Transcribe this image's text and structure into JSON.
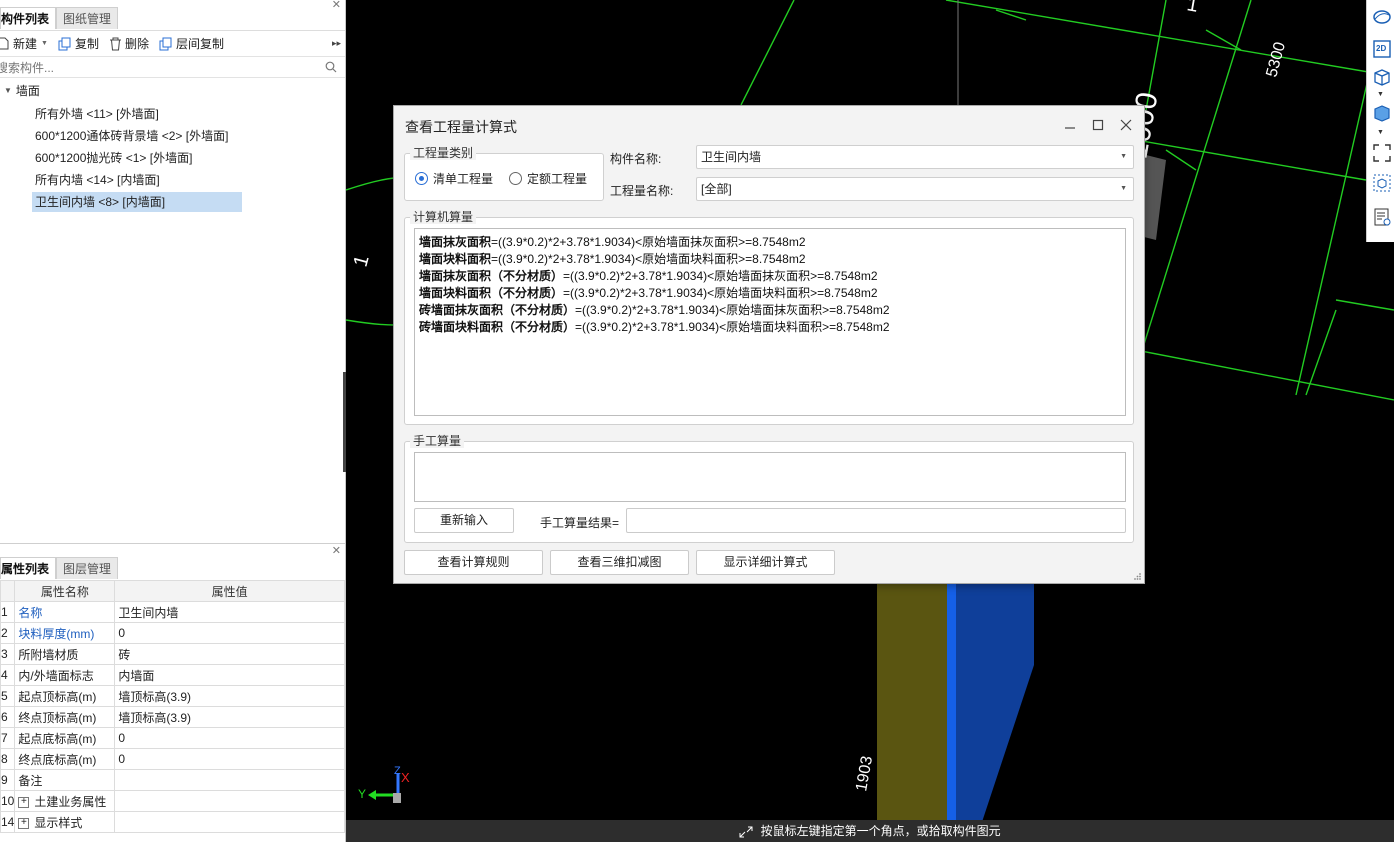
{
  "left_top": {
    "tabs": [
      {
        "label": "构件列表"
      },
      {
        "label": "图纸管理"
      }
    ],
    "toolbar": {
      "new": "新建",
      "copy": "复制",
      "delete": "删除",
      "floor_copy": "层间复制"
    },
    "search": {
      "placeholder": "搜索构件..."
    },
    "tree": {
      "root": "墙面",
      "items": [
        {
          "label": "所有外墙 <11> [外墙面]"
        },
        {
          "label": "600*1200通体砖背景墙 <2> [外墙面]"
        },
        {
          "label": "600*1200抛光砖 <1> [外墙面]"
        },
        {
          "label": "所有内墙 <14> [内墙面]"
        },
        {
          "label": "卫生间内墙 <8> [内墙面]"
        }
      ]
    }
  },
  "left_bottom": {
    "tabs": [
      {
        "label": "属性列表"
      },
      {
        "label": "图层管理"
      }
    ],
    "headers": {
      "name": "属性名称",
      "value": "属性值"
    },
    "rows": [
      {
        "num": "1",
        "name": "名称",
        "value": "卫生间内墙"
      },
      {
        "num": "2",
        "name": "块料厚度(mm)",
        "value": "0"
      },
      {
        "num": "3",
        "name": "所附墙材质",
        "value": "砖"
      },
      {
        "num": "4",
        "name": "内/外墙面标志",
        "value": "内墙面"
      },
      {
        "num": "5",
        "name": "起点顶标高(m)",
        "value": "墙顶标高(3.9)"
      },
      {
        "num": "6",
        "name": "终点顶标高(m)",
        "value": "墙顶标高(3.9)"
      },
      {
        "num": "7",
        "name": "起点底标高(m)",
        "value": "0"
      },
      {
        "num": "8",
        "name": "终点底标高(m)",
        "value": "0"
      },
      {
        "num": "9",
        "name": "备注",
        "value": ""
      },
      {
        "num": "10",
        "name": "土建业务属性",
        "value": ""
      },
      {
        "num": "14",
        "name": "显示样式",
        "value": ""
      }
    ]
  },
  "viewport": {
    "dims": {
      "d1": "5300",
      "d2": "1000",
      "d3": "1",
      "d4": "1",
      "d5": "1903"
    },
    "axes": {
      "x": "X",
      "y": "Y",
      "z": "Z"
    },
    "status": "按鼠标左键指定第一个角点，或拾取构件图元"
  },
  "right_tools": {
    "btn_2d": "2D"
  },
  "dialog": {
    "title": "查看工程量计算式",
    "qty_type": {
      "label": "工程量类别",
      "opt1": "清单工程量",
      "opt2": "定额工程量"
    },
    "component": {
      "label": "构件名称:",
      "value": "卫生间内墙"
    },
    "qty_name": {
      "label": "工程量名称:",
      "value": "[全部]"
    },
    "machine": {
      "label": "计算机算量",
      "lines": [
        {
          "bold": "墙面抹灰面积",
          "rest": "=((3.9*0.2)*2+3.78*1.9034)<原始墙面抹灰面积>=8.7548m2"
        },
        {
          "bold": "墙面块料面积",
          "rest": "=((3.9*0.2)*2+3.78*1.9034)<原始墙面块料面积>=8.7548m2"
        },
        {
          "bold": "墙面抹灰面积（不分材质）",
          "rest": "=((3.9*0.2)*2+3.78*1.9034)<原始墙面抹灰面积>=8.7548m2"
        },
        {
          "bold": "墙面块料面积（不分材质）",
          "rest": "=((3.9*0.2)*2+3.78*1.9034)<原始墙面块料面积>=8.7548m2"
        },
        {
          "bold": "砖墙面抹灰面积（不分材质）",
          "rest": "=((3.9*0.2)*2+3.78*1.9034)<原始墙面抹灰面积>=8.7548m2"
        },
        {
          "bold": "砖墙面块料面积（不分材质）",
          "rest": "=((3.9*0.2)*2+3.78*1.9034)<原始墙面块料面积>=8.7548m2"
        }
      ]
    },
    "manual": {
      "label": "手工算量",
      "reinput": "重新输入",
      "result_label": "手工算量结果="
    },
    "buttons": {
      "rules": "查看计算规则",
      "view3d": "查看三维扣减图",
      "detail": "显示详细计算式"
    }
  }
}
